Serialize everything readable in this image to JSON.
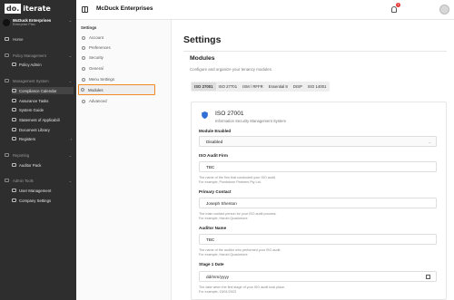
{
  "app": {
    "logo_left": "do.",
    "logo_right": "iterate",
    "org_name": "McDuck Enterprises",
    "org_plan": "Enterprise Plan"
  },
  "sidebar": {
    "home": "Home",
    "groups": [
      {
        "label": "Policy Management",
        "items": [
          "Policy Admin"
        ]
      },
      {
        "label": "Management System",
        "items": [
          "Compliance Calendar",
          "Assurance Tasks",
          "System Guide",
          "Statement of Applicabili",
          "Document Library",
          "Registers"
        ]
      },
      {
        "label": "Reporting",
        "items": [
          "Auditor Pack"
        ]
      },
      {
        "label": "Admin Tools",
        "items": [
          "User Management",
          "Company Settings"
        ]
      }
    ]
  },
  "topbar": {
    "title": "McDuck Enterprises",
    "notification_count": "1"
  },
  "settings_menu": {
    "title": "Settings",
    "items": [
      "Account",
      "Preferences",
      "Security",
      "General",
      "Menu Settings",
      "Modules",
      "Advanced"
    ],
    "active": "Modules"
  },
  "main": {
    "page_title": "Settings",
    "section_title": "Modules",
    "section_desc": "Configure and organize your tenancy modules.",
    "tabs": [
      "ISO 27001",
      "ISO 27701",
      "ISM / RFFR",
      "Essential 8",
      "DISP",
      "ISO 14001"
    ],
    "active_tab": "ISO 27001",
    "card": {
      "title": "ISO 27001",
      "subtitle": "Information Security Management System",
      "fields": {
        "module_enabled": {
          "label": "Module Enabled",
          "value": "Disabled"
        },
        "audit_firm": {
          "label": "ISO Audit Firm",
          "value": "TBC",
          "help1": "The name of the firm that conducted your ISO audit.",
          "help2": "For example, Pondstone Partners Pty Ltd."
        },
        "primary_contact": {
          "label": "Primary Contact",
          "value": "Joseph Shenton",
          "help1": "The main contact person for your ISO audit process.",
          "help2": "For example, Harold Quackmore."
        },
        "auditor_name": {
          "label": "Auditor Name",
          "value": "TBC",
          "help1": "The name of the auditor who performed your ISO audit.",
          "help2": "For example, Harold Quackmore."
        },
        "stage1_date": {
          "label": "Stage 1 Date",
          "value": "dd/mm/yyyy",
          "help1": "The date when the first stage of your ISO audit took place.",
          "help2": "For example, 15/01/2023"
        }
      }
    }
  },
  "colors": {
    "sidebar_bg": "#2e2e2e",
    "active_outline": "#f08a24",
    "badge": "#e53935"
  }
}
